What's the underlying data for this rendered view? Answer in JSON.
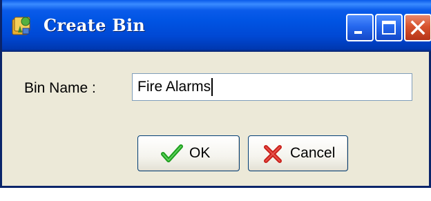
{
  "window": {
    "title": "Create Bin"
  },
  "titlebar_buttons": {
    "minimize": "minimize-icon",
    "maximize": "maximize-icon",
    "close": "close-icon"
  },
  "form": {
    "bin_name_label": "Bin Name :",
    "bin_name_value": "Fire Alarms"
  },
  "buttons": {
    "ok_label": "OK",
    "ok_icon": "checkmark-icon",
    "cancel_label": "Cancel",
    "cancel_icon": "x-mark-icon"
  },
  "colors": {
    "titlebar": "#0054E3",
    "window_body": "#ECE9D8",
    "close_button": "#D8532D",
    "ok_check": "#1E9E1E",
    "cancel_x": "#C8201A"
  }
}
